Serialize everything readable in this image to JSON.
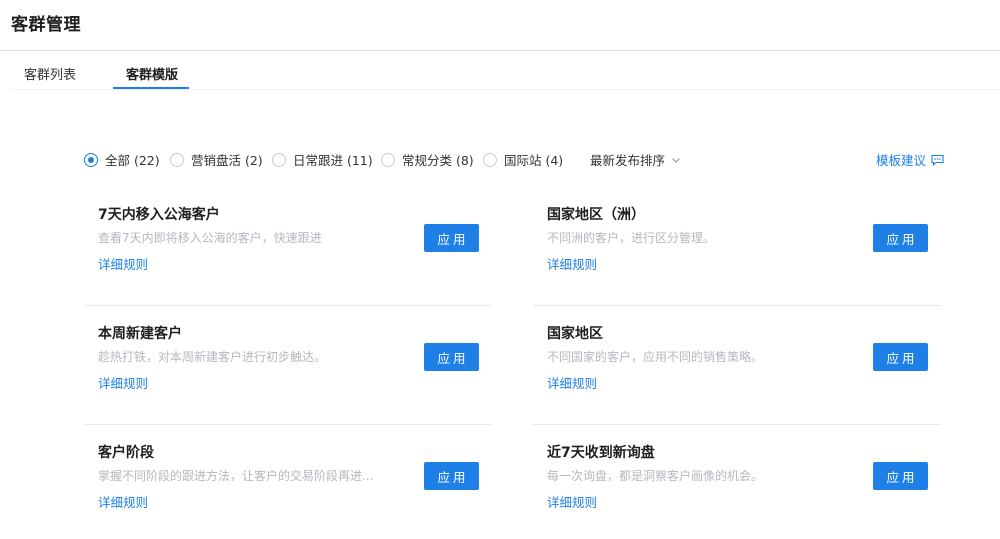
{
  "header": {
    "title": "客群管理"
  },
  "tabs": [
    {
      "label": "客群列表",
      "active": false
    },
    {
      "label": "客群模版",
      "active": true
    }
  ],
  "filters": {
    "options": [
      {
        "label": "全部 (22)",
        "checked": true
      },
      {
        "label": "营销盘活 (2)",
        "checked": false
      },
      {
        "label": "日常跟进 (11)",
        "checked": false
      },
      {
        "label": "常规分类 (8)",
        "checked": false
      },
      {
        "label": "国际站 (4)",
        "checked": false
      }
    ],
    "sort_label": "最新发布排序",
    "suggest_label": "模板建议"
  },
  "cards": [
    {
      "title": "7天内移入公海客户",
      "desc": "查看7天内即将移入公海的客户，快速跟进",
      "link": "详细规则",
      "button": "应用"
    },
    {
      "title": "国家地区（洲）",
      "desc": "不同洲的客户，进行区分管理。",
      "link": "详细规则",
      "button": "应用"
    },
    {
      "title": "本周新建客户",
      "desc": "趁热打铁，对本周新建客户进行初步触达。",
      "link": "详细规则",
      "button": "应用"
    },
    {
      "title": "国家地区",
      "desc": "不同国家的客户，应用不同的销售策略。",
      "link": "详细规则",
      "button": "应用"
    },
    {
      "title": "客户阶段",
      "desc": "掌握不同阶段的跟进方法，让客户的交易阶段再进...",
      "link": "详细规则",
      "button": "应用"
    },
    {
      "title": "近7天收到新询盘",
      "desc": "每一次询盘，都是洞察客户画像的机会。",
      "link": "详细规则",
      "button": "应用"
    }
  ],
  "colors": {
    "accent": "#1e7fe6",
    "muted_text": "#b4b8bd",
    "divider": "#e8eaed"
  },
  "icons": {
    "sort": "chevron-down-icon",
    "suggest": "message-icon"
  }
}
